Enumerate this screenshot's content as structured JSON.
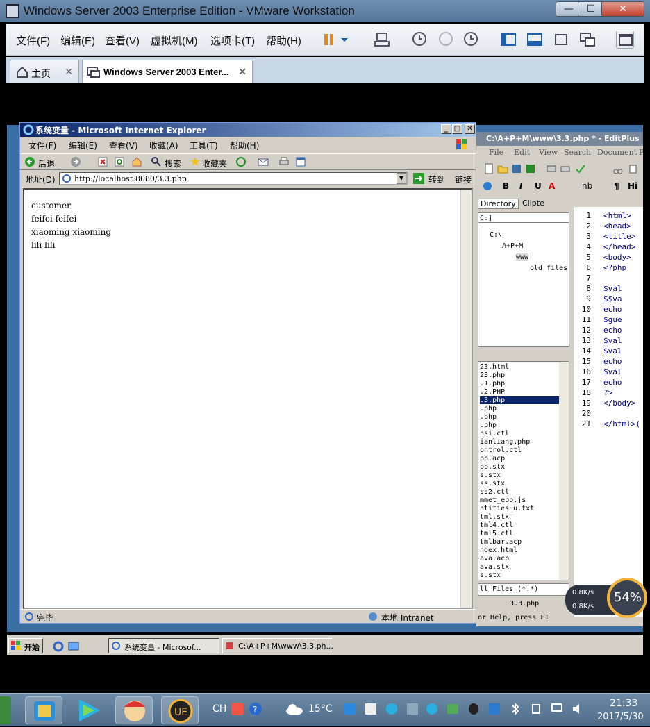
{
  "vmware": {
    "title": "Windows Server 2003 Enterprise Edition - VMware Workstation",
    "menu": [
      "文件(F)",
      "编辑(E)",
      "查看(V)",
      "虚拟机(M)",
      "选项卡(T)",
      "帮助(H)"
    ],
    "tabs": [
      {
        "label": "主页"
      },
      {
        "label": "Windows Server 2003 Enter..."
      }
    ],
    "window_buttons": {
      "minimize": "—",
      "maximize": "☐",
      "close": "✕"
    }
  },
  "ie": {
    "title": "系统变量 - Microsoft Internet Explorer",
    "menu": [
      "文件(F)",
      "编辑(E)",
      "查看(V)",
      "收藏(A)",
      "工具(T)",
      "帮助(H)"
    ],
    "toolbar": {
      "back": "后退",
      "search": "搜索",
      "favorites": "收藏夹"
    },
    "address_label": "地址(D)",
    "address_value": "http://localhost:8080/3.3.php",
    "go_label": "转到",
    "links_label": "链接",
    "content_lines": [
      "customer",
      "feifei feifei",
      "xiaoming xiaoming",
      "lili lili"
    ],
    "status_text": "完毕",
    "zone_text": "本地 Intranet"
  },
  "editplus": {
    "title": "C:\\A+P+M\\www\\3.3.php * - EditPlus",
    "menu": [
      "File",
      "Edit",
      "View",
      "Search",
      "Document",
      "P"
    ],
    "toolbar2": [
      "B",
      "I",
      "U",
      "A",
      "nb",
      "¶",
      "Hi"
    ],
    "panel_tabs": [
      "Directory",
      "Clipte"
    ],
    "drive": "C:]",
    "tree": [
      "C:\\",
      "A+P+M",
      "www",
      "old files"
    ],
    "files": [
      "23.html",
      "23.php",
      ".1.php",
      ".2.PHP",
      ".3.php",
      ".php",
      ".php",
      ".php",
      "nsi.ctl",
      "ianliang.php",
      "ontrol.ctl",
      "pp.acp",
      "pp.stx",
      "s.stx",
      "ss.stx",
      "ss2.ctl",
      "mmet_epp.js",
      "ntities_u.txt",
      "tml.stx",
      "tml4.ctl",
      "tml5.ctl",
      "tmlbar.acp",
      "ndex.html",
      "ava.acp",
      "ava.stx",
      "s.stx"
    ],
    "selected_file_index": 4,
    "filter": "ll Files (*.*)",
    "doc_tab": "3.3.php",
    "status": "or Help, press F1",
    "ruler": "----+---",
    "line_numbers": [
      "1",
      "2",
      "3",
      "4",
      "5",
      "6",
      "7",
      "8",
      "9",
      "10",
      "11",
      "12",
      "13",
      "14",
      "15",
      "16",
      "17",
      "18",
      "19",
      "20",
      "21"
    ],
    "code_lines": [
      "<html>",
      "<head>",
      "<title>",
      "</head>",
      "<body>",
      "<?php",
      "",
      "    $val",
      "    $$va",
      "    echo",
      "    $gue",
      "    echo",
      "    $val",
      "    $val",
      "    echo",
      "    $val",
      "    echo",
      "?>",
      "</body>",
      "",
      "</html>("
    ]
  },
  "guest_taskbar": {
    "start_label": "开始",
    "tasks": [
      "系统变量 - Microsof...",
      "C:\\A+P+M\\www\\3.3.ph..."
    ]
  },
  "speed_widget": {
    "upload": "0.8K/s",
    "download": "0.8K/s",
    "percent": "54%",
    "accent": "#f2b33d"
  },
  "host_taskbar": {
    "lang": "CH",
    "temperature": "15°C",
    "time": "21:33",
    "date": "2017/5/30"
  }
}
